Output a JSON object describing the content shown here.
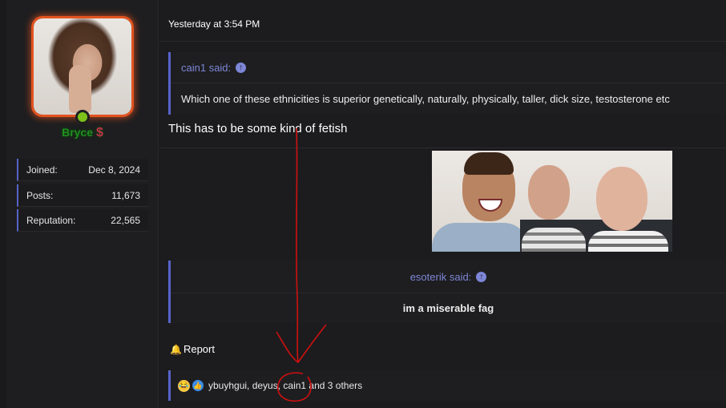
{
  "user": {
    "username": "Bryce",
    "badge": "$",
    "status_color": "#7cc21a",
    "avatar_border_color": "#e2531f",
    "stats": [
      {
        "key": "Joined:",
        "value": "Dec 8, 2024"
      },
      {
        "key": "Posts:",
        "value": "11,673"
      },
      {
        "key": "Reputation:",
        "value": "22,565"
      }
    ]
  },
  "post": {
    "date": "Yesterday at 3:54 PM",
    "quote1": {
      "author": "cain1 said:",
      "text": "Which one of these ethnicities is superior genetically, naturally, physically, taller, dick size, testosterone etc"
    },
    "body": "This has to be some kind of fetish",
    "quote2": {
      "author": "esoterik said:",
      "text": "im a miserable fag"
    },
    "report_label": "Report",
    "reactions": {
      "text_before": "ybuyhgui, deyus, ",
      "highlight": "cain1",
      "text_after": " and 3 others",
      "icons": [
        "laughing-emoji-icon",
        "thumbs-up-icon"
      ]
    }
  },
  "colors": {
    "accent": "#5764c9",
    "quote_author": "#7d86d6",
    "annotation": "#d01010"
  }
}
